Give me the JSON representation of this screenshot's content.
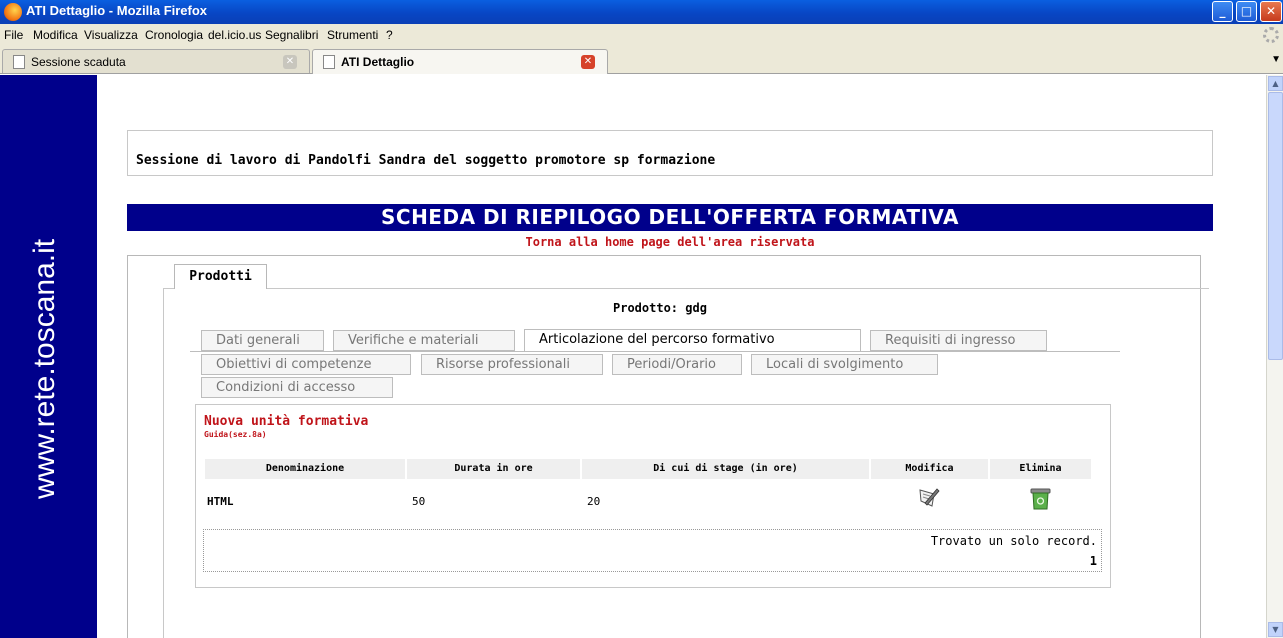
{
  "window": {
    "title": "ATI Dettaglio - Mozilla Firefox"
  },
  "menu": [
    "File",
    "Modifica",
    "Visualizza",
    "Cronologia",
    "del.icio.us",
    "Segnalibri",
    "Strumenti",
    "?"
  ],
  "browser_tabs": [
    {
      "label": "Sessione scaduta",
      "active": false
    },
    {
      "label": "ATI Dettaglio",
      "active": true
    }
  ],
  "sidebar": {
    "brand": "www.rete.toscana.it"
  },
  "page": {
    "session_text": "Sessione di lavoro di Pandolfi Sandra del soggetto promotore sp formazione",
    "banner_title": "SCHEDA DI RIEPILOGO DELL'OFFERTA FORMATIVA",
    "home_link": "Torna alla home page dell'area riservata",
    "products_tab": "Prodotti",
    "product_label": "Prodotto: gdg",
    "tabs": [
      "Dati generali",
      "Verifiche e materiali",
      "Articolazione del percorso formativo",
      "Requisiti di ingresso",
      "Obiettivi di competenze",
      "Risorse professionali",
      "Periodi/Orario",
      "Locali di svolgimento",
      "Condizioni di accesso"
    ],
    "active_tab": "Articolazione del percorso formativo",
    "new_unit_link": "Nuova unità formativa",
    "guide_link": "Guida(sez.8a)",
    "table": {
      "headers": [
        "Denominazione",
        "Durata in ore",
        "Di cui di stage (in ore)",
        "Modifica",
        "Elimina"
      ],
      "rows": [
        {
          "denominazione": "HTML",
          "durata": "50",
          "stage": "20"
        }
      ]
    },
    "record_text": "Trovato un solo record.",
    "page_number": "1"
  },
  "colors": {
    "brand_blue": "#00008b",
    "link_red": "#c0141a",
    "titlebar_blue": "#0a5fe0"
  }
}
